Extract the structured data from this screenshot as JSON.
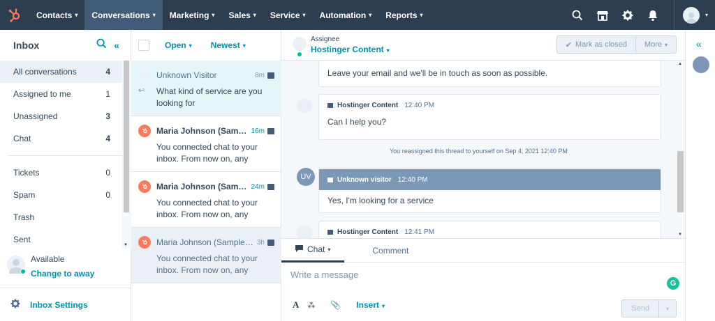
{
  "topnav": {
    "items": [
      {
        "label": "Contacts"
      },
      {
        "label": "Conversations"
      },
      {
        "label": "Marketing"
      },
      {
        "label": "Sales"
      },
      {
        "label": "Service"
      },
      {
        "label": "Automation"
      },
      {
        "label": "Reports"
      }
    ],
    "active_index": 1
  },
  "sidebar": {
    "title": "Inbox",
    "items": [
      {
        "label": "All conversations",
        "count": "4"
      },
      {
        "label": "Assigned to me",
        "count": "1"
      },
      {
        "label": "Unassigned",
        "count": "3"
      },
      {
        "label": "Chat",
        "count": "4"
      },
      {
        "label": "Tickets",
        "count": "0"
      },
      {
        "label": "Spam",
        "count": "0"
      },
      {
        "label": "Trash",
        "count": ""
      },
      {
        "label": "Sent",
        "count": ""
      }
    ],
    "status": {
      "label": "Available",
      "link": "Change to away"
    },
    "settings_label": "Inbox Settings"
  },
  "threadlist": {
    "filter_status": "Open",
    "filter_sort": "Newest",
    "threads": [
      {
        "name": "Unknown Visitor",
        "time": "8m",
        "preview": "What kind of service are you looking for"
      },
      {
        "name": "Maria Johnson (Sample...",
        "time": "16m",
        "preview": "You connected chat to your inbox. From now on, any chats..."
      },
      {
        "name": "Maria Johnson (Samp...",
        "time": "24m",
        "preview": "You connected chat to your inbox. From now on, any chats..."
      },
      {
        "name": "Maria Johnson (Sample ...",
        "time": "3h",
        "preview": "You connected chat to your inbox. From now on, any chats..."
      }
    ]
  },
  "main": {
    "assignee_label": "Assignee",
    "assignee_name": "Hostinger Content",
    "mark_closed": "Mark as closed",
    "more": "More",
    "messages": [
      {
        "body": "Leave your email and we'll be in touch as soon as possible."
      },
      {
        "sender": "Hostinger Content",
        "time": "12:40 PM",
        "body": "Can I help you?"
      },
      {
        "system": "You reassigned this thread to yourself on Sep 4, 2021 12:40 PM"
      },
      {
        "sender": "Unknown visitor",
        "time": "12:40 PM",
        "body": "Yes, I'm looking for a service",
        "initials": "UV"
      },
      {
        "sender": "Hostinger Content",
        "time": "12:41 PM"
      }
    ],
    "composer": {
      "tab_chat": "Chat",
      "tab_comment": "Comment",
      "placeholder": "Write a message",
      "insert": "Insert",
      "send": "Send"
    }
  },
  "colors": {
    "nav_bg": "#2d3e50",
    "accent": "#0091ae",
    "hubspot_orange": "#ff7a59",
    "online": "#00bda5"
  }
}
